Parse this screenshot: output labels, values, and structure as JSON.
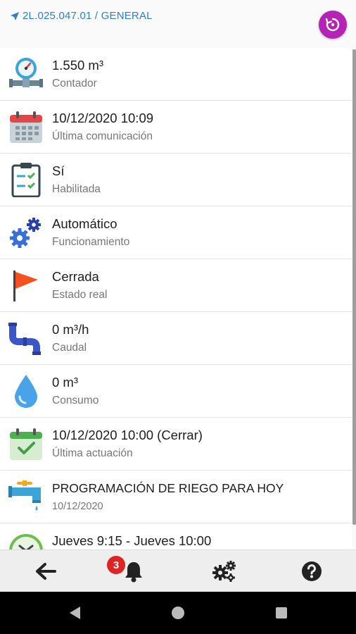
{
  "header": {
    "breadcrumb": "2L.025.047.01 / GENERAL",
    "refresh_icon": "history-refresh-icon",
    "accent": "#b523b5",
    "link_color": "#2f7fd1"
  },
  "rows": [
    {
      "icon": "meter-gauge-icon",
      "primary": "1.550 m³",
      "secondary": "Contador"
    },
    {
      "icon": "calendar-icon",
      "primary": "10/12/2020 10:09",
      "secondary": "Última comunicación"
    },
    {
      "icon": "clipboard-checklist-icon",
      "primary": "Sí",
      "secondary": "Habilitada"
    },
    {
      "icon": "gears-icon",
      "primary": "Automático",
      "secondary": "Funcionamiento"
    },
    {
      "icon": "red-flag-icon",
      "primary": "Cerrada",
      "secondary": "Estado real"
    },
    {
      "icon": "pipe-icon",
      "primary": "0 m³/h",
      "secondary": "Caudal"
    },
    {
      "icon": "water-drop-icon",
      "primary": "0 m³",
      "secondary": "Consumo"
    },
    {
      "icon": "calendar-check-icon",
      "primary": "10/12/2020 10:00 (Cerrar)",
      "secondary": "Última actuación"
    },
    {
      "icon": "faucet-icon",
      "primary": "PROGRAMACIÓN DE RIEGO PARA HOY",
      "secondary": "10/12/2020"
    },
    {
      "icon": "clock-icon",
      "primary": "Jueves 9:15 - Jueves 10:00",
      "secondary": ""
    }
  ],
  "bottom_nav": {
    "back_icon": "arrow-left-icon",
    "notifications_icon": "bell-icon",
    "notifications_count": "3",
    "settings_icon": "gears-icon",
    "help_icon": "help-circle-icon",
    "badge_color": "#e02424"
  },
  "system_nav": {
    "back": "triangle-back-icon",
    "home": "circle-home-icon",
    "recents": "square-recents-icon"
  }
}
